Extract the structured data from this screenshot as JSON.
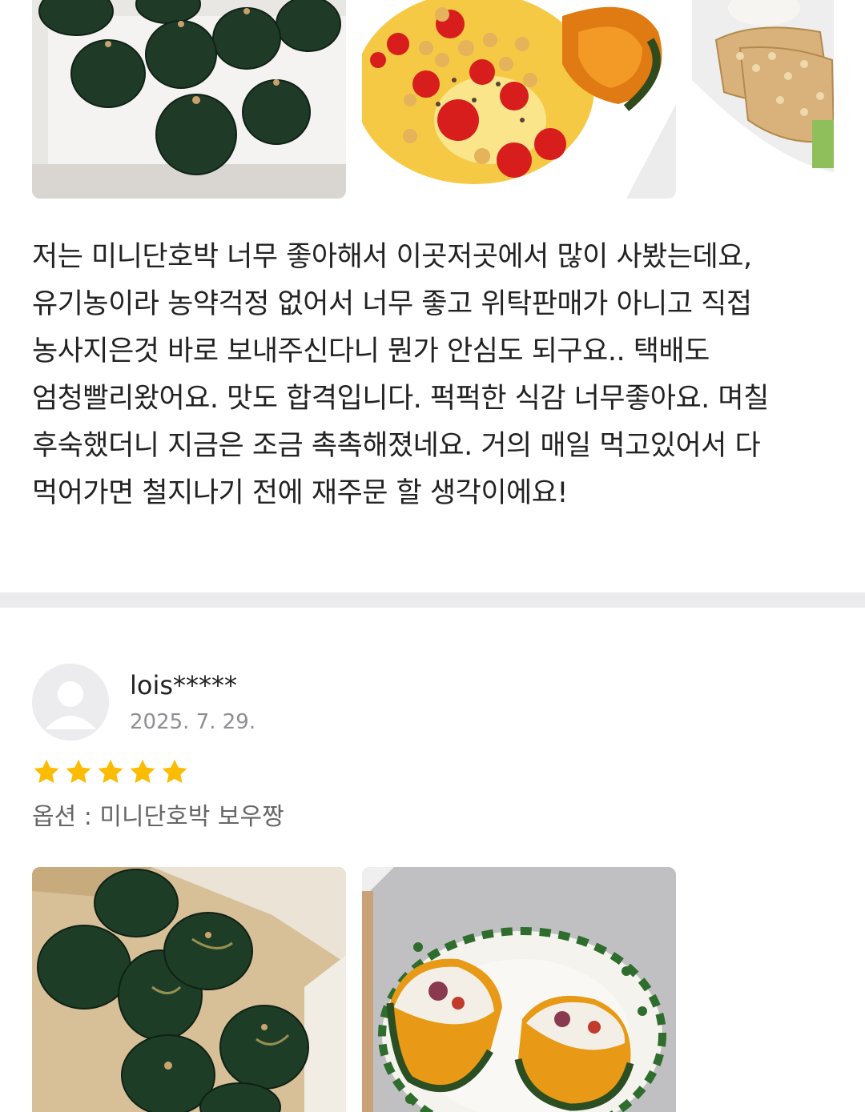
{
  "review_previous": {
    "photos": [
      {
        "icon": "mini-pumpkins-on-tray-photo"
      },
      {
        "icon": "chickpea-tomato-pumpkin-salad-photo"
      },
      {
        "icon": "tempeh-bowl-photo"
      }
    ],
    "body": "저는 미니단호박 너무 좋아해서 이곳저곳에서 많이 사봤는데요, 유기농이라 농약걱정 없어서 너무 좋고 위탁판매가 아니고 직접 농사지은것 바로 보내주신다니 뭔가 안심도 되구요.. 택배도 엄청빨리왔어요. 맛도 합격입니다. 퍽퍽한 식감 너무좋아요. 며칠 후숙했더니 지금은 조금 촉촉해졌네요. 거의 매일 먹고있어서 다 먹어가면 철지나기 전에 재주문 할 생각이에요!"
  },
  "review_current": {
    "avatar_icon": "default-user-avatar-icon",
    "username": "lois*****",
    "date": "2025. 7. 29.",
    "rating": 5,
    "rating_max": 5,
    "star_color": "#fbbc05",
    "option": "옵션 : 미니단호박 보우짱",
    "photos": [
      {
        "icon": "pumpkins-in-box-photo"
      },
      {
        "icon": "stuffed-pumpkin-on-plate-photo"
      }
    ]
  },
  "colors": {
    "divider": "#ebebed",
    "text": "#222222",
    "meta": "#8e8e93",
    "option": "#666666"
  }
}
